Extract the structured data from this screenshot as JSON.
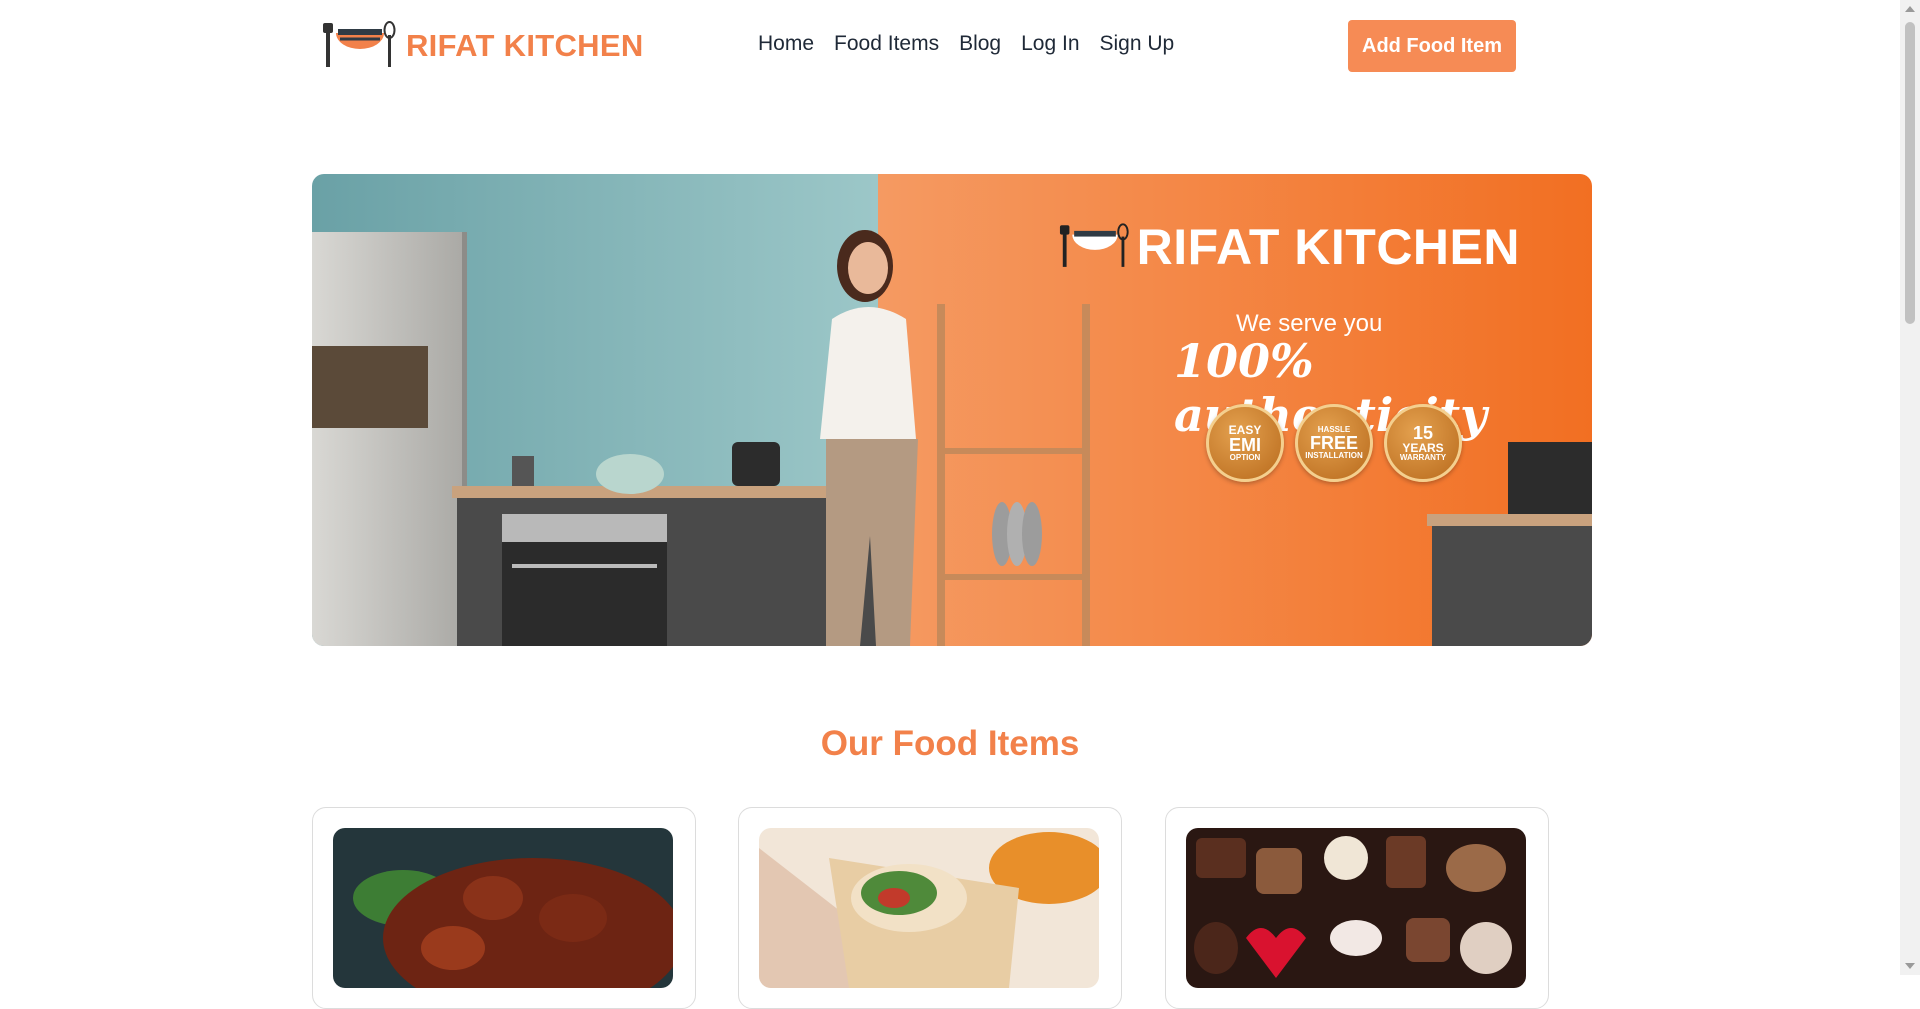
{
  "brand": {
    "name": "RIFAT KITCHEN",
    "logo_icon": "kitchen-bowl-utensils-icon"
  },
  "nav": {
    "items": [
      {
        "label": "Home"
      },
      {
        "label": "Food Items"
      },
      {
        "label": "Blog"
      },
      {
        "label": "Log In"
      },
      {
        "label": "Sign Up"
      }
    ],
    "cta_label": "Add Food Item"
  },
  "hero": {
    "brand_name": "RIFAT KITCHEN",
    "tagline": "We serve you",
    "headline": "100% authenticity",
    "badges": [
      {
        "top": "EASY",
        "mid": "EMI",
        "bottom": "OPTION"
      },
      {
        "top": "HASSLE",
        "mid": "FREE",
        "bottom": "INSTALLATION"
      },
      {
        "top": "15",
        "mid": "YEARS",
        "bottom": "WARRANTY"
      }
    ]
  },
  "section": {
    "title": "Our Food Items"
  },
  "colors": {
    "brand": "#f2814a",
    "button": "#f68b55",
    "hero_left": "#8dbcbf",
    "hero_right": "#f57a35"
  }
}
